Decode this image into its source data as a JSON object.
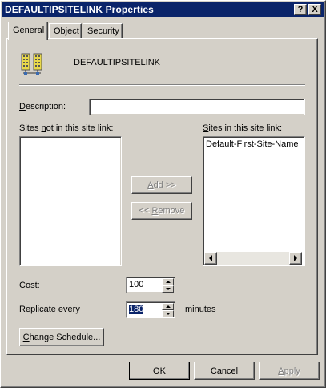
{
  "window": {
    "title": "DEFAULTIPSITELINK Properties",
    "help_button": "?",
    "close_button": "X"
  },
  "tabs": [
    {
      "label": "General",
      "active": true
    },
    {
      "label": "Object",
      "active": false
    },
    {
      "label": "Security",
      "active": false
    }
  ],
  "header": {
    "object_name": "DEFAULTIPSITELINK",
    "icon": "site-link-icon"
  },
  "description": {
    "label_prefix": "",
    "label_mnemonic": "D",
    "label_rest": "escription:",
    "value": ""
  },
  "sites_not_in": {
    "label_pre": "Sites ",
    "label_mnemonic": "n",
    "label_post": "ot in this site link:",
    "items": []
  },
  "sites_in": {
    "label_mnemonic": "S",
    "label_post": "ites in this site link:",
    "items": [
      "Default-First-Site-Name"
    ]
  },
  "buttons": {
    "add_mnemonic": "A",
    "add_rest": "dd >>",
    "remove_pre": "<< ",
    "remove_mnemonic": "R",
    "remove_rest": "emove",
    "change_schedule_mnemonic": "C",
    "change_schedule_rest": "hange Schedule...",
    "ok": "OK",
    "cancel": "Cancel",
    "apply_mnemonic": "A",
    "apply_rest": "pply"
  },
  "cost": {
    "label_pre": "C",
    "label_mnemonic": "o",
    "label_post": "st:",
    "value": "100"
  },
  "replicate": {
    "label_pre": "R",
    "label_mnemonic": "e",
    "label_post": "plicate every",
    "value": "180",
    "unit": "minutes"
  },
  "colors": {
    "titlebar": "#0a246a",
    "face": "#d4d0c8"
  }
}
